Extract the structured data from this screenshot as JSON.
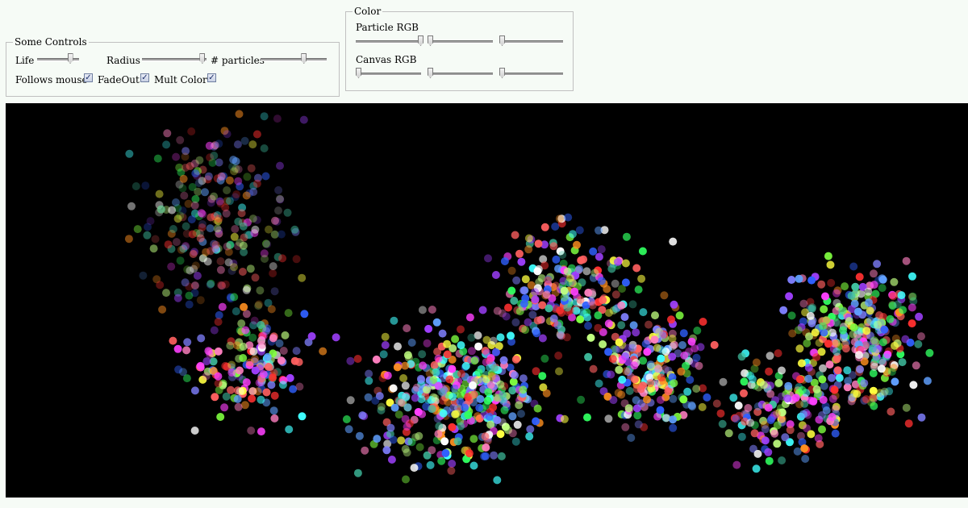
{
  "controls": {
    "legend": "Some Controls",
    "life_label": "Life",
    "life_value": 0.78,
    "radius_label": "Radius",
    "radius_value": 0.93,
    "particles_label": "# particles",
    "particles_value": 0.65,
    "follows_mouse_label": "Follows mouse",
    "follows_mouse_checked": true,
    "fadeout_label": "FadeOut",
    "fadeout_checked": true,
    "mult_color_label": "Mult Color",
    "mult_color_checked": true
  },
  "color": {
    "legend": "Color",
    "particle_rgb_label": "Particle RGB",
    "particle_r": 1.0,
    "particle_g": 0.0,
    "particle_b": 0.0,
    "canvas_rgb_label": "Canvas RGB",
    "canvas_r": 0.0,
    "canvas_g": 0.0,
    "canvas_b": 0.0
  },
  "canvas": {
    "background": "#000000",
    "particle_palette": [
      "#ff3030",
      "#30ff60",
      "#3060ff",
      "#ffff40",
      "#ff40ff",
      "#40ffff",
      "#ff9020",
      "#a040ff",
      "#80ff40",
      "#ff80c0",
      "#40c0a0",
      "#ffffff",
      "#8080ff",
      "#c0ff80",
      "#ff6060",
      "#60a0ff"
    ]
  }
}
